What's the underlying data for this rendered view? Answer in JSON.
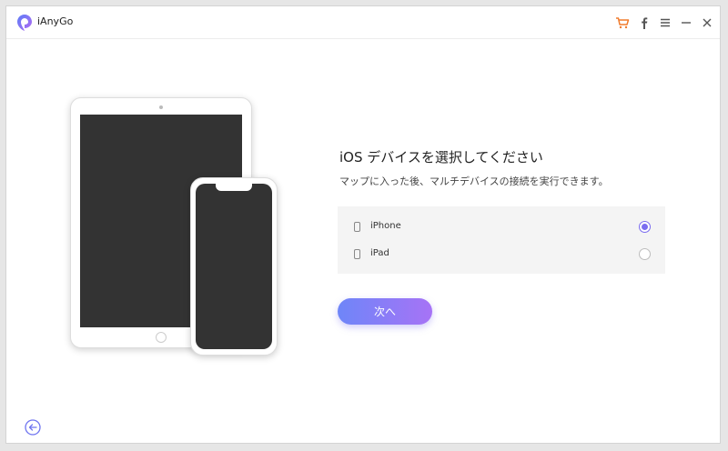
{
  "app": {
    "title": "iAnyGo",
    "accent_color": "#7a6cf0",
    "cart_color": "#f07b2c"
  },
  "titlebar": {
    "icons": [
      "cart-icon",
      "facebook-icon",
      "menu-icon",
      "minimize-icon",
      "close-icon"
    ]
  },
  "main": {
    "heading": "iOS デバイスを選択してください",
    "subheading": "マップに入った後、マルチデバイスの接続を実行できます。",
    "devices": [
      {
        "label": "iPhone",
        "selected": true
      },
      {
        "label": "iPad",
        "selected": false
      }
    ],
    "next_label": "次へ"
  },
  "footer": {
    "back_icon": "back-arrow-icon"
  }
}
